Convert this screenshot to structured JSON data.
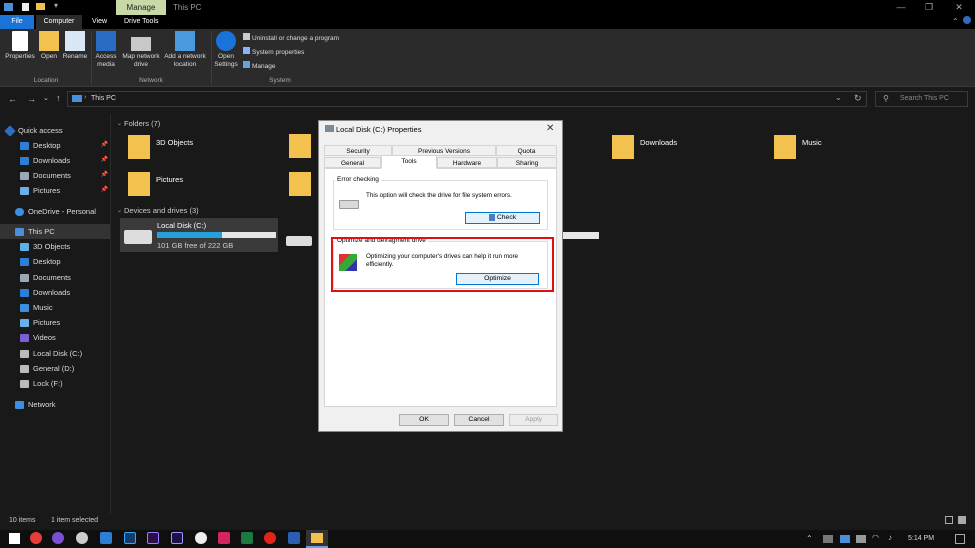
{
  "titlebar": {
    "context_tab": "Manage",
    "title": "This PC"
  },
  "ribbon_tabs": {
    "file": "File",
    "computer": "Computer",
    "view": "View",
    "drive_tools": "Drive Tools"
  },
  "ribbon": {
    "properties": "Properties",
    "open": "Open",
    "rename": "Rename",
    "access_media": "Access media",
    "map_network_drive": "Map network drive",
    "add_network_location": "Add a network location",
    "open_settings": "Open Settings",
    "uninstall": "Uninstall or change a program",
    "system_properties": "System properties",
    "manage": "Manage",
    "group_location": "Location",
    "group_network": "Network",
    "group_system": "System"
  },
  "address": {
    "path": "This PC",
    "search_placeholder": "Search This PC"
  },
  "sidebar": {
    "quick_access": "Quick access",
    "qa_items": [
      "Desktop",
      "Downloads",
      "Documents",
      "Pictures"
    ],
    "onedrive": "OneDrive - Personal",
    "this_pc": "This PC",
    "pc_items": [
      "3D Objects",
      "Desktop",
      "Documents",
      "Downloads",
      "Music",
      "Pictures",
      "Videos",
      "Local Disk (C:)",
      "General (D:)",
      "Lock (F:)"
    ],
    "network": "Network"
  },
  "content": {
    "folders_header": "Folders (7)",
    "folders": [
      "3D Objects",
      "Pictures",
      "Downloads",
      "Music"
    ],
    "devices_header": "Devices and drives (3)",
    "drive_name": "Local Disk (C:)",
    "drive_free": "101 GB free of 222 GB",
    "drive_used_fraction": 0.55
  },
  "status": {
    "items": "10 items",
    "selected": "1 item selected"
  },
  "dialog": {
    "title": "Local Disk (C:) Properties",
    "tabs_row1": [
      "Security",
      "Previous Versions",
      "Quota"
    ],
    "tabs_row2": [
      "General",
      "Tools",
      "Hardware",
      "Sharing"
    ],
    "error_checking": {
      "legend": "Error checking",
      "text": "This option will check the drive for file system errors.",
      "button": "Check"
    },
    "optimize": {
      "legend": "Optimize and defragment drive",
      "text": "Optimizing your computer's drives can help it run more efficiently.",
      "button": "Optimize"
    },
    "ok": "OK",
    "cancel": "Cancel",
    "apply": "Apply"
  },
  "taskbar": {
    "time": "5:14 PM"
  },
  "colors": {
    "accent": "#1a73d8",
    "highlight": "#e01010",
    "folder": "#f2c14e"
  }
}
